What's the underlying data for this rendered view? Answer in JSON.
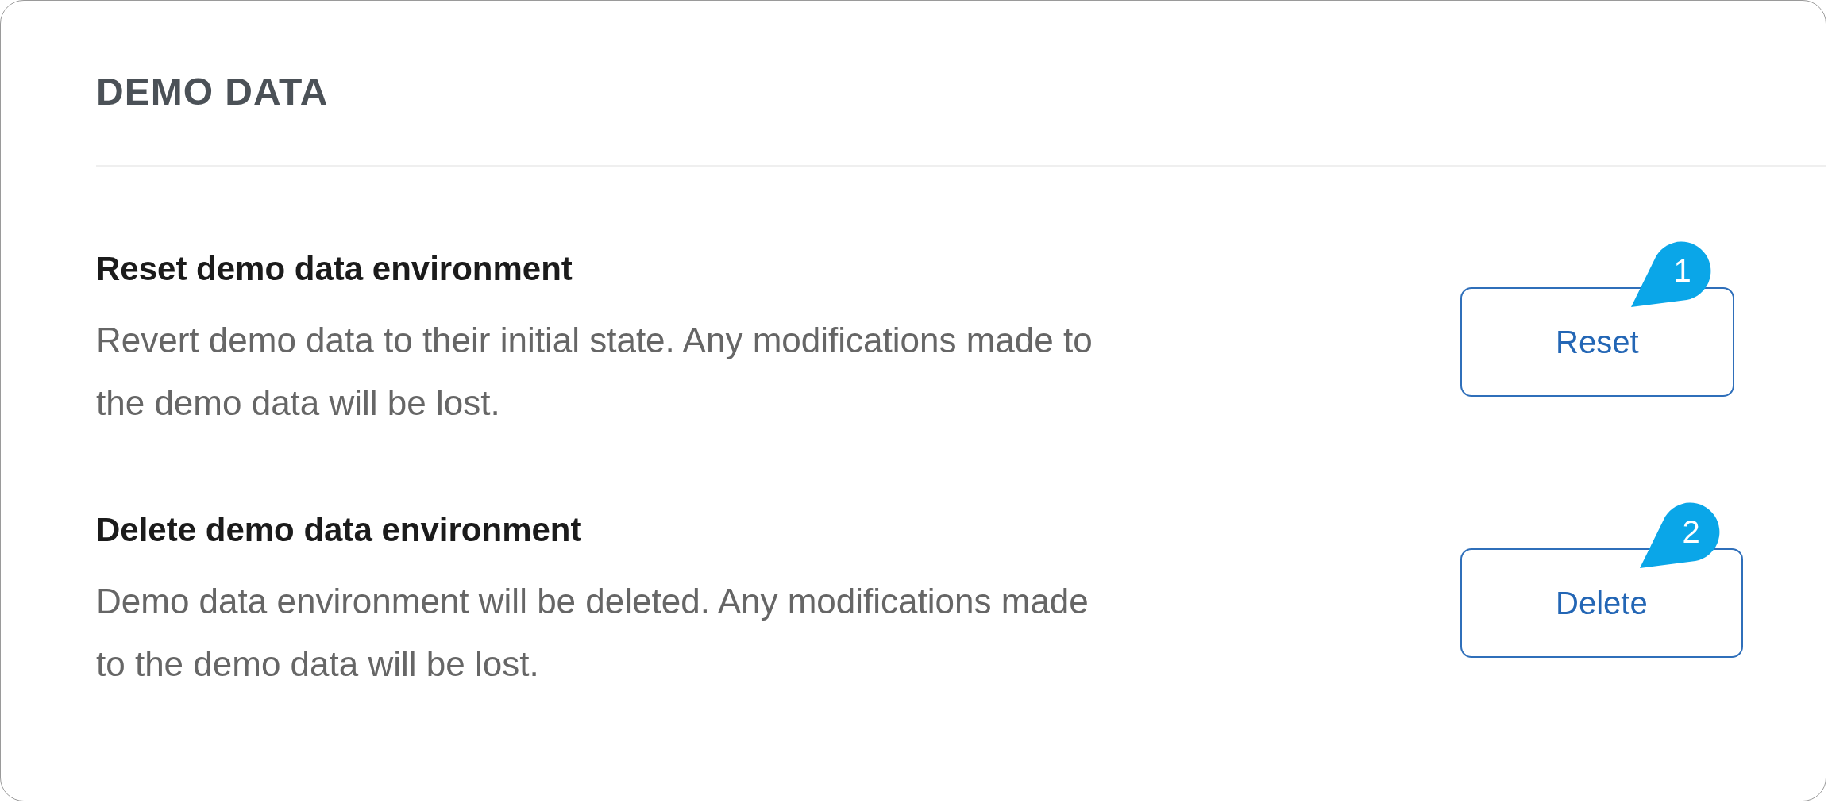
{
  "section": {
    "title": "DEMO DATA"
  },
  "settings": [
    {
      "title": "Reset demo data environment",
      "description": "Revert demo data to their initial state. Any modifications made to the demo data will be lost.",
      "button": "Reset",
      "callout": "1"
    },
    {
      "title": "Delete demo data environment",
      "description": "Demo data environment will be deleted. Any modifications made to the demo data will be lost.",
      "button": "Delete",
      "callout": "2"
    }
  ]
}
